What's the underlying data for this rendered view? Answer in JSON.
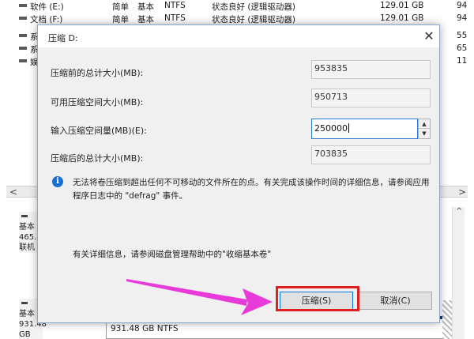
{
  "volumes": [
    {
      "name": "软件 (E:)",
      "layout": "简单",
      "type": "基本",
      "fs": "NTFS",
      "status": "状态良好 (逻辑驱动器)",
      "capacity": "129.01 GB",
      "right": "94"
    },
    {
      "name": "文档 (F:)",
      "layout": "简单",
      "type": "基本",
      "fs": "NTFS",
      "status": "状态良好 (逻辑驱动器)",
      "capacity": "129.01 GB",
      "right": "94"
    },
    {
      "name": "系",
      "right": "55"
    },
    {
      "name": "系",
      "right": "65"
    },
    {
      "name": "娱",
      "right": "11"
    }
  ],
  "disks": [
    {
      "dash": "",
      "line1": "基本",
      "line2": "465.",
      "line3": "联机"
    },
    {
      "dash": "",
      "line1": "基本",
      "line2": "931.48 GB"
    }
  ],
  "disk1_partition": "931.48 GB NTFS",
  "dialog": {
    "title": "压缩 D:",
    "close_glyph": "✕",
    "fields": {
      "total_before_label": "压缩前的总计大小(MB):",
      "total_before_value": "953835",
      "available_label": "可用压缩空间大小(MB):",
      "available_value": "950713",
      "input_label": "输入压缩空间量(MB)(E):",
      "input_value": "250000",
      "total_after_label": "压缩后的总计大小(MB):",
      "total_after_value": "703835"
    },
    "info_icon": "i",
    "info_text": "无法将卷压缩到超出任何不可移动的文件所在的点。有关完成该操作时间的详细信息，请参阅应用程序日志中的 \"defrag\" 事件。",
    "help_text": "有关详细信息，请参阅磁盘管理帮助中的\"收缩基本卷\"",
    "shrink_button": "压缩(S)",
    "cancel_button": "取消(C)"
  },
  "scroll": {
    "left_arrow": "<",
    "right_arrow": ">",
    "up_arrow": "^"
  },
  "colors": {
    "highlight": "#e02020",
    "arrow": "#e83ad9",
    "accent": "#0078d7"
  }
}
